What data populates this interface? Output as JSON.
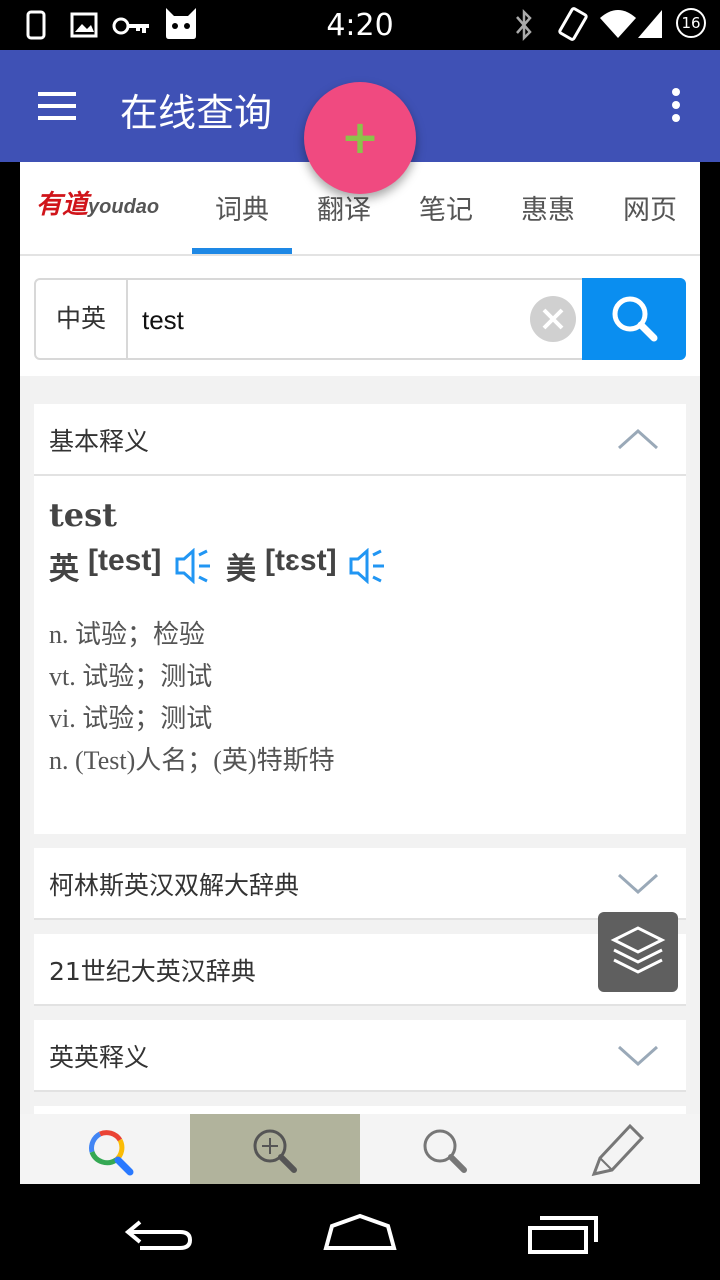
{
  "status_bar": {
    "time": "4:20",
    "notification_badge": "16"
  },
  "toolbar": {
    "title": "在线查询",
    "background": "#3f51b5"
  },
  "fab": {
    "label": "+",
    "color": "#f04a80"
  },
  "tabs": {
    "logo_text": "有道",
    "logo_sub": "youdao",
    "items": [
      {
        "label": "词典",
        "active": true
      },
      {
        "label": "翻译"
      },
      {
        "label": "笔记"
      },
      {
        "label": "惠惠"
      },
      {
        "label": "网页"
      }
    ]
  },
  "search": {
    "lang": "中英",
    "query": "test"
  },
  "basic": {
    "header": "基本释义",
    "word": "test",
    "uk_label": "英",
    "uk_phonetic": "[test]",
    "us_label": "美",
    "us_phonetic": "[tɛst]",
    "definitions": [
      "n. 试验；检验",
      "vt. 试验；测试",
      "vi. 试验；测试",
      "n. (Test)人名；(英)特斯特"
    ]
  },
  "sections": [
    {
      "label": "柯林斯英汉双解大辞典"
    },
    {
      "label": "21世纪大英汉辞典"
    },
    {
      "label": "英英释义"
    }
  ],
  "colors": {
    "accent_blue": "#0a8ef0",
    "speaker_blue": "#2196f3",
    "tab_indicator": "#1e88e5"
  }
}
